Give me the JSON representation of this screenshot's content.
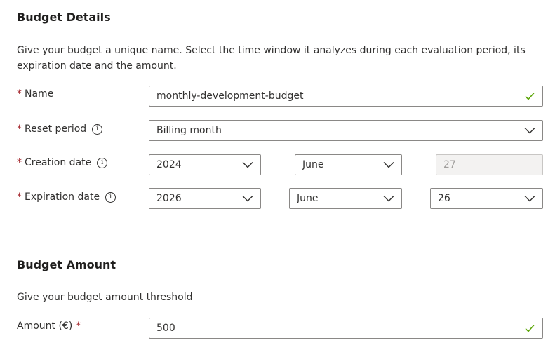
{
  "details": {
    "title": "Budget Details",
    "description": "Give your budget a unique name. Select the time window it analyzes during each evaluation period, its expiration date and the amount.",
    "name": {
      "label": "Name",
      "required_mark": "*",
      "value": "monthly-development-budget"
    },
    "reset_period": {
      "label": "Reset period",
      "required_mark": "*",
      "info": "i",
      "value": "Billing month"
    },
    "creation_date": {
      "label": "Creation date",
      "required_mark": "*",
      "info": "i",
      "year": "2024",
      "month": "June",
      "day": "27"
    },
    "expiration_date": {
      "label": "Expiration date",
      "required_mark": "*",
      "info": "i",
      "year": "2026",
      "month": "June",
      "day": "26"
    }
  },
  "amount": {
    "title": "Budget Amount",
    "description": "Give your budget amount threshold",
    "field": {
      "label": "Amount (€)",
      "required_mark": "*",
      "value": "500"
    }
  },
  "colors": {
    "required": "#a4262c",
    "valid_check": "#57a300",
    "border": "#8a8886",
    "disabled_bg": "#f3f2f1"
  }
}
